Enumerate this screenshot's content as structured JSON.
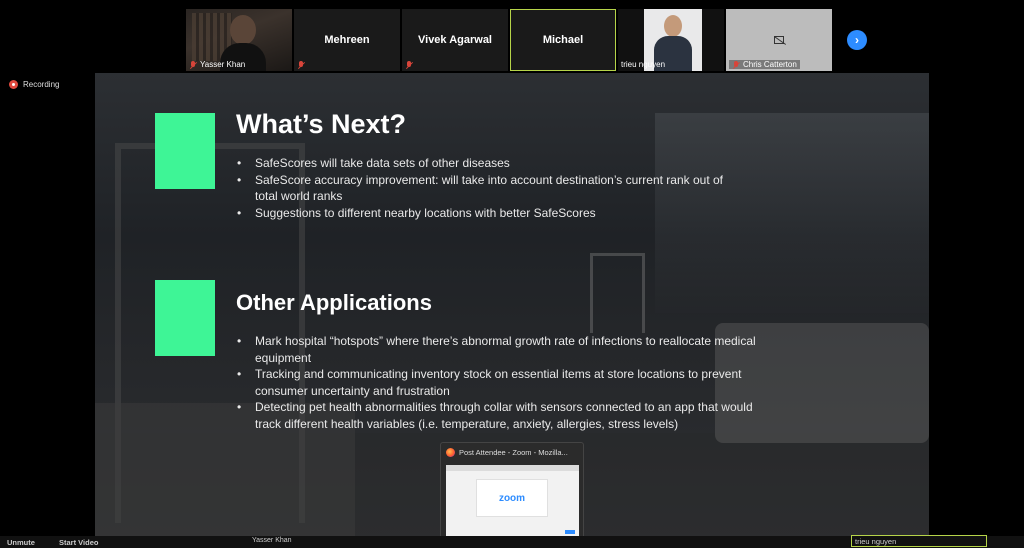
{
  "participants": [
    {
      "name": "Yasser Khan",
      "caption": "Yasser Khan",
      "muted": true,
      "video": true
    },
    {
      "name": "Mehreen",
      "muted": true,
      "video": false
    },
    {
      "name": "Vivek Agarwal",
      "muted": true,
      "video": false
    },
    {
      "name": "Michael",
      "active_speaker": true,
      "video": false
    },
    {
      "name": "trieu nguyen",
      "caption": "trieu nguyen",
      "video": true
    },
    {
      "name": "Chris Catterton",
      "caption": "Chris Catterton",
      "muted": true,
      "video": false
    }
  ],
  "strip_next_icon": "chevron-right-icon",
  "recording_label": "Recording",
  "slide": {
    "section1": {
      "title": "What’s Next?",
      "bullets": [
        "SafeScores will take data sets of other diseases",
        "SafeScore accuracy improvement: will take into account destination’s current rank out of total world ranks",
        "Suggestions to different nearby locations with better SafeScores"
      ]
    },
    "section2": {
      "title": "Other Applications",
      "bullets": [
        "Mark hospital “hotspots” where there’s abnormal growth rate of infections to reallocate medical equipment",
        "Tracking and communicating inventory stock on essential items at store locations to prevent consumer uncertainty and frustration",
        "Detecting pet health abnormalities through collar with sensors connected to an app that would track different health variables (i.e. temperature, anxiety, allergies, stress levels)"
      ]
    },
    "accent_color": "#3ef596"
  },
  "window_preview": {
    "title": "Post Attendee - Zoom - Mozilla...",
    "logo_text": "zoom"
  },
  "bottom_bar": {
    "unmute_label": "Unmute",
    "start_video_label": "Start Video",
    "self_caption": "Yasser Khan",
    "speaker_name": "trieu nguyen"
  }
}
